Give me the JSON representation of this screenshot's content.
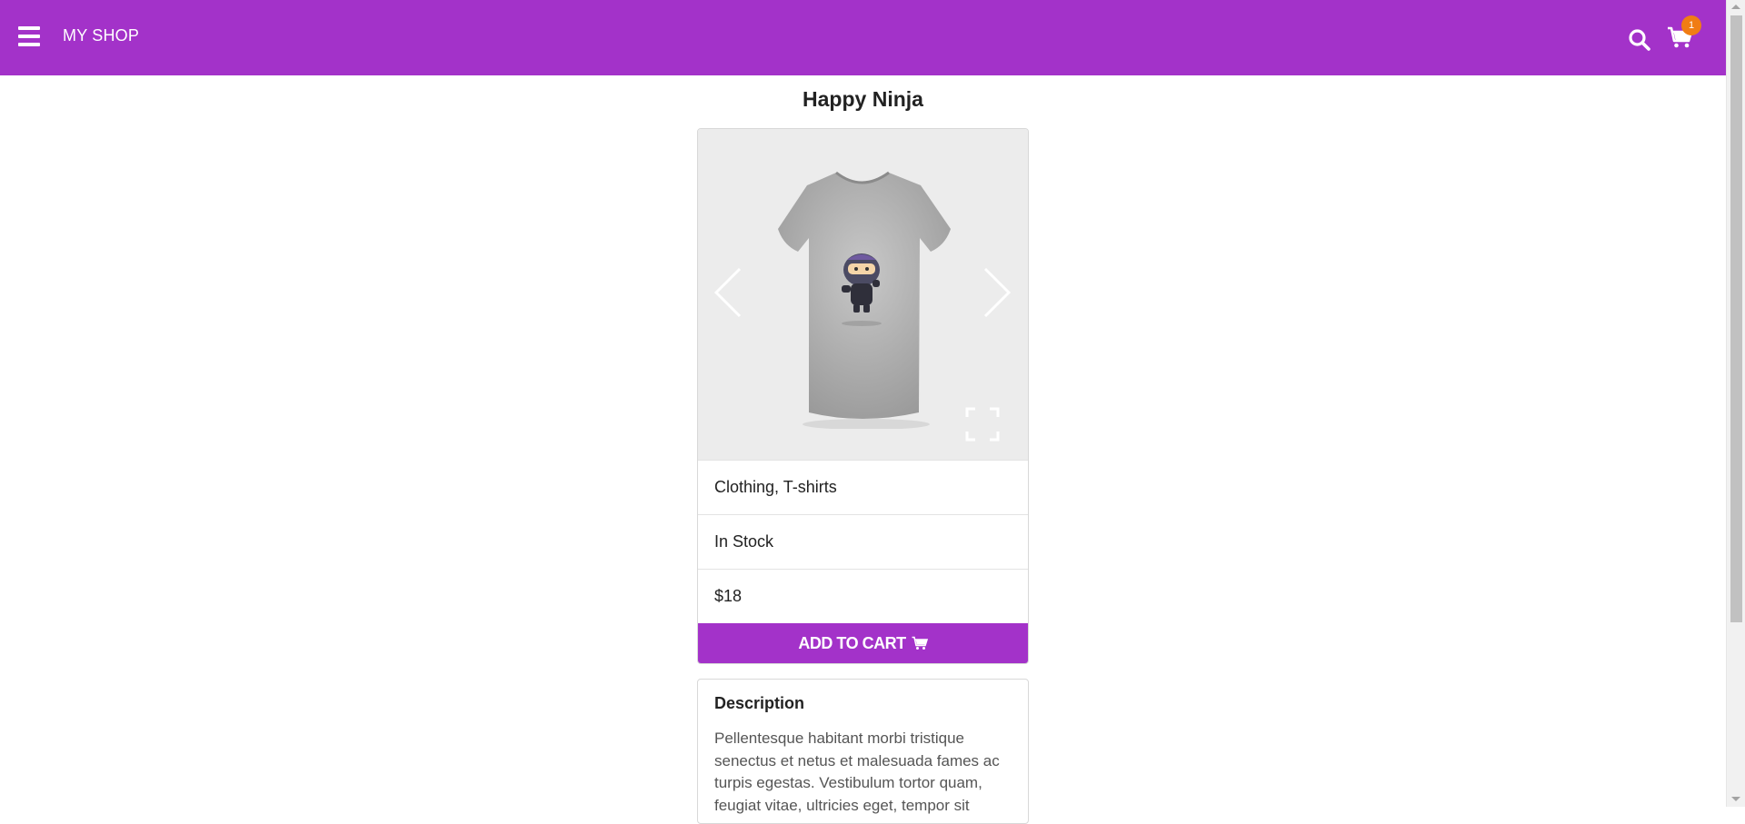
{
  "header": {
    "brand": "MY SHOP",
    "cart_count": "1",
    "accent_color": "#a332c9",
    "badge_color": "#f07d14",
    "icons": [
      "hamburger-menu-icon",
      "search-icon",
      "cart-icon"
    ]
  },
  "product": {
    "title": "Happy Ninja",
    "gallery_icons": [
      "chevron-left-icon",
      "chevron-right-icon",
      "fullscreen-icon"
    ],
    "categories": "Clothing, T-shirts",
    "stock": "In Stock",
    "price": "$18",
    "add_to_cart_label": "ADD TO CART"
  },
  "description": {
    "title": "Description",
    "text": "Pellentesque habitant morbi tristique senectus et netus et malesuada fames ac turpis egestas. Vestibulum tortor quam, feugiat vitae, ultricies eget, tempor sit"
  }
}
